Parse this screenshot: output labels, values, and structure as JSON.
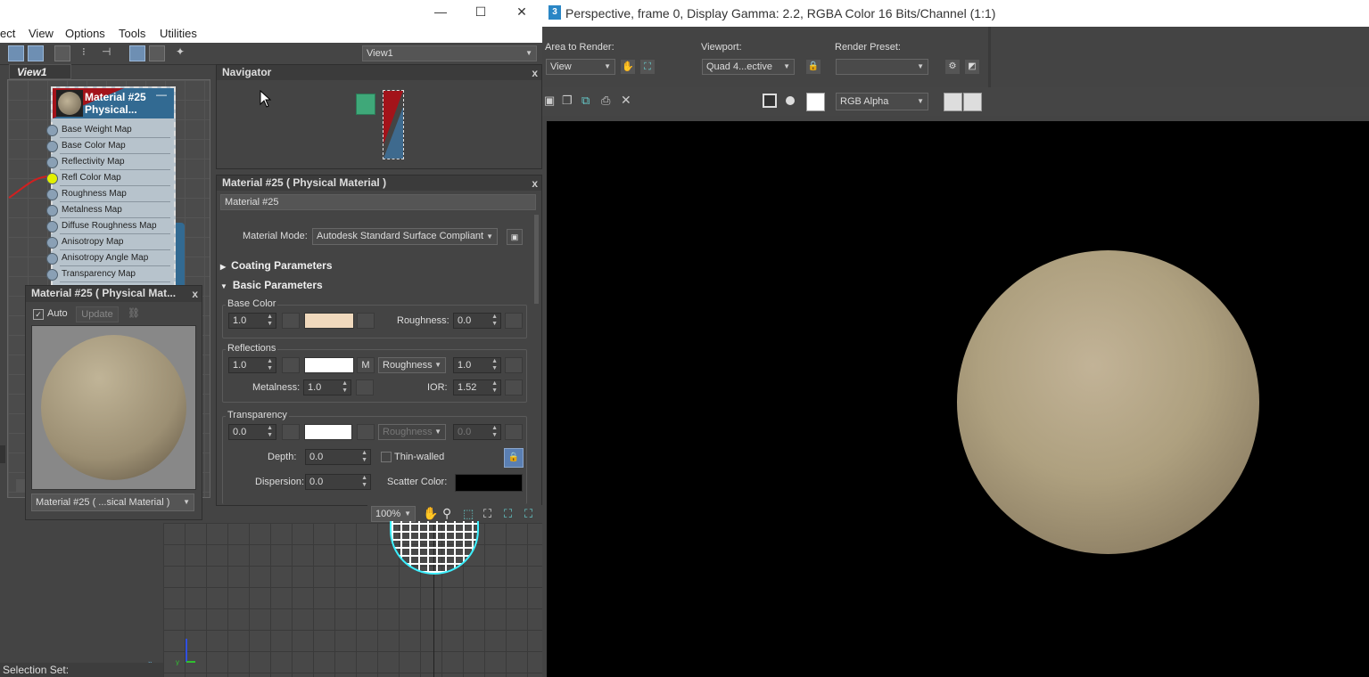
{
  "slate": {
    "window_controls": {
      "minimize": "—",
      "maximize": "☐",
      "close": "✕"
    },
    "menu": [
      "ect",
      "View",
      "Options",
      "Tools",
      "Utilities"
    ],
    "view_dropdown": "View1",
    "view_tab": "View1",
    "node": {
      "title_line1": "Material #25",
      "title_line2": "Physical...",
      "collapse": "—",
      "slots": [
        "Base Weight Map",
        "Base Color Map",
        "Reflectivity Map",
        "Refl Color Map",
        "Roughness Map",
        "Metalness Map",
        "Diffuse Roughness Map",
        "Anisotropy Map",
        "Anisotropy Angle Map",
        "Transparency Map"
      ]
    },
    "navigator": {
      "title": "Navigator",
      "close": "x"
    },
    "preview": {
      "title": "Material #25 ( Physical Mat...",
      "close": "x",
      "auto_label": "Auto",
      "update_label": "Update",
      "material_dropdown": "Material #25 ( ...sical Material )"
    },
    "params": {
      "title": "Material #25  ( Physical Material )",
      "close": "x",
      "name_value": "Material #25",
      "material_mode_label": "Material Mode:",
      "material_mode_value": "Autodesk Standard Surface Compliant",
      "coating_rollout": "Coating Parameters",
      "basic_rollout": "Basic Parameters",
      "base_color": {
        "group": "Base Color",
        "weight": "1.0",
        "roughness_label": "Roughness:",
        "roughness": "0.0",
        "swatch": "#f0d9bd"
      },
      "reflections": {
        "group": "Reflections",
        "weight": "1.0",
        "m_label": "M",
        "mode": "Roughness",
        "roughness": "1.0",
        "metalness_label": "Metalness:",
        "metalness": "1.0",
        "ior_label": "IOR:",
        "ior": "1.52",
        "swatch": "#ffffff"
      },
      "transparency": {
        "group": "Transparency",
        "weight": "0.0",
        "mode": "Roughness",
        "roughness": "0.0",
        "depth_label": "Depth:",
        "depth": "0.0",
        "thin_walled": "Thin-walled",
        "dispersion_label": "Dispersion:",
        "dispersion": "0.0",
        "scatter_label": "Scatter Color:",
        "swatch": "#ffffff",
        "scatter_swatch": "#000000"
      }
    },
    "zoom": "100%",
    "status": "Selection Set:"
  },
  "render": {
    "title": "Perspective, frame 0, Display Gamma: 2.2, RGBA Color 16 Bits/Channel (1:1)",
    "area_label": "Area to Render:",
    "area_value": "View",
    "viewport_label": "Viewport:",
    "viewport_value": "Quad 4...ective",
    "preset_label": "Render Preset:",
    "preset_value": "",
    "channel": "RGB Alpha",
    "channel_colors": {
      "red": "#e0202a",
      "green": "#2aa040",
      "blue": "#2aa0e0"
    }
  }
}
